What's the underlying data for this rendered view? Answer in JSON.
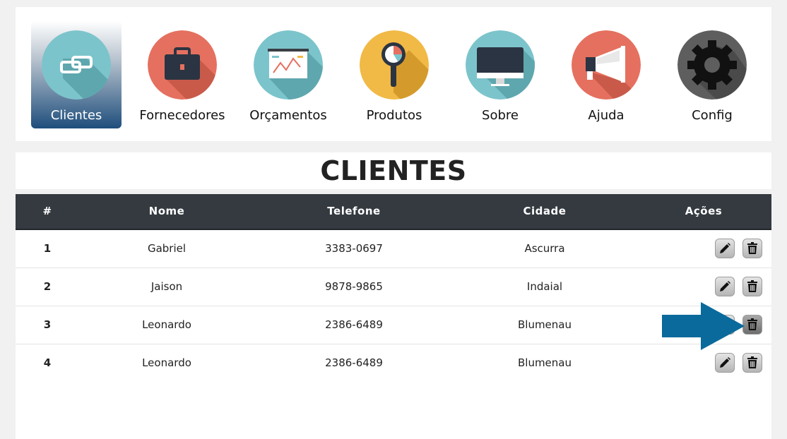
{
  "nav": {
    "items": [
      {
        "label": "Clientes",
        "icon": "link-icon",
        "color": "#7cc4cb",
        "active": true
      },
      {
        "label": "Fornecedores",
        "icon": "briefcase-icon",
        "color": "#e5705f"
      },
      {
        "label": "Orçamentos",
        "icon": "presentation-chart-icon",
        "color": "#7cc4cb"
      },
      {
        "label": "Produtos",
        "icon": "magnifier-icon",
        "color": "#f1b945"
      },
      {
        "label": "Sobre",
        "icon": "monitor-icon",
        "color": "#7cc4cb"
      },
      {
        "label": "Ajuda",
        "icon": "megaphone-icon",
        "color": "#e5705f"
      },
      {
        "label": "Config",
        "icon": "gear-icon",
        "color": "#5e5e5e"
      }
    ]
  },
  "page": {
    "title": "CLIENTES"
  },
  "table": {
    "headers": {
      "num": "#",
      "nome": "Nome",
      "telefone": "Telefone",
      "cidade": "Cidade",
      "acoes": "Ações"
    },
    "rows": [
      {
        "num": "1",
        "nome": "Gabriel",
        "telefone": "3383-0697",
        "cidade": "Ascurra"
      },
      {
        "num": "2",
        "nome": "Jaison",
        "telefone": "9878-9865",
        "cidade": "Indaial"
      },
      {
        "num": "3",
        "nome": "Leonardo",
        "telefone": "2386-6489",
        "cidade": "Blumenau"
      },
      {
        "num": "4",
        "nome": "Leonardo",
        "telefone": "2386-6489",
        "cidade": "Blumenau"
      }
    ],
    "actions": {
      "edit_icon": "pencil-icon",
      "delete_icon": "trash-icon"
    }
  },
  "annotation": {
    "arrow_color": "#0a6a9b",
    "points_to": "row 3 delete button"
  },
  "colors": {
    "header_bg": "#343a40",
    "active_nav": "#1f4e7c"
  }
}
